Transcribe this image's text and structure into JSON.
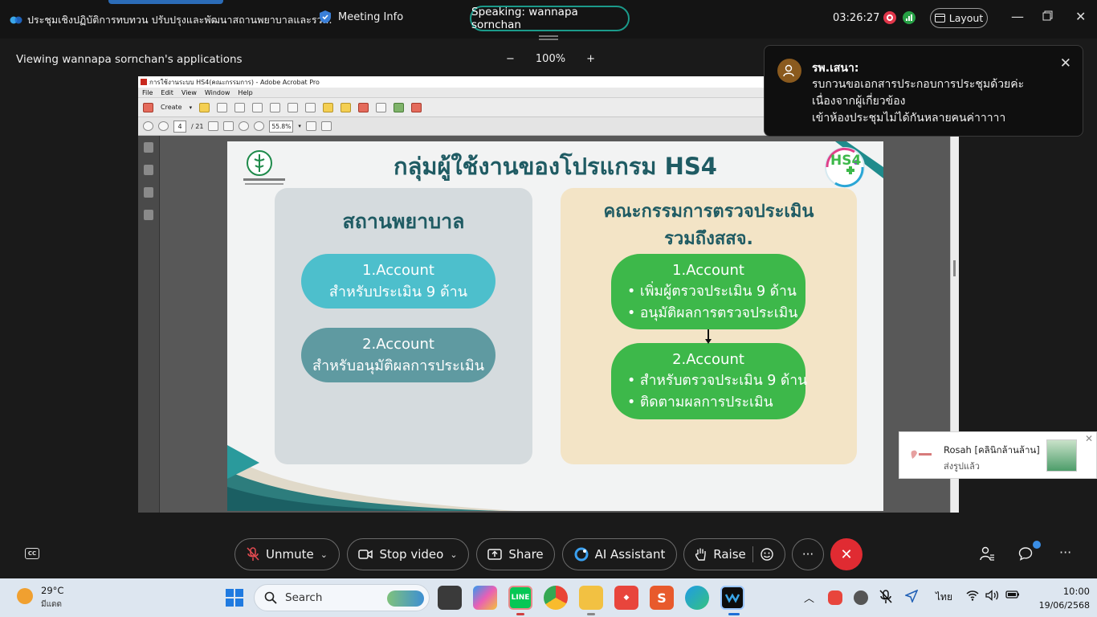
{
  "topbar": {
    "meeting_title": "ประชุมเชิงปฏิบัติการทบทวน ปรับปรุงและพัฒนาสถานพยาบาลและรว...",
    "meeting_info_label": "Meeting Info",
    "speaking_label": "Speaking: wannapa sornchan",
    "elapsed_time": "03:26:27",
    "layout_label": "Layout"
  },
  "share": {
    "viewing_label": "Viewing wannapa sornchan's applications",
    "zoom_minus": "−",
    "zoom_level": "100%",
    "zoom_plus": "+"
  },
  "acrobat": {
    "window_title": "การใช้งานระบบ HS4(คณะกรรมการ) - Adobe Acrobat Pro",
    "menu": [
      "File",
      "Edit",
      "View",
      "Window",
      "Help"
    ],
    "create_label": "Create",
    "page_current": "4",
    "page_total": "/ 21",
    "zoom_value": "55.8%"
  },
  "slide": {
    "title": "กลุ่มผู้ใช้งานของโปรแกรม HS4",
    "left_panel": {
      "heading": "สถานพยาบาล",
      "account1_title": "1.Account",
      "account1_desc": "สำหรับประเมิน 9 ด้าน",
      "account2_title": "2.Account",
      "account2_desc": "สำหรับอนุมัติผลการประเมิน"
    },
    "right_panel": {
      "heading_line1": "คณะกรรมการตรวจประเมิน",
      "heading_line2": "รวมถึงสสจ.",
      "account1_title": "1.Account",
      "account1_bullets": [
        "•  เพิ่มผู้ตรวจประเมิน 9 ด้าน",
        "•  อนุมัติผลการตรวจประเมิน"
      ],
      "account2_title": "2.Account",
      "account2_bullets": [
        "•  สำหรับตรวจประเมิน 9 ด้าน",
        "•  ติดตามผลการประเมิน"
      ]
    },
    "logo_right_text": "HS4"
  },
  "chat_notification": {
    "sender": "รพ.เสนา:",
    "message_lines": [
      "รบกวนขอเอกสารประกอบการประชุมด้วยค่ะ",
      "เนื่องจากผู้เกี่ยวข้อง",
      "เข้าห้องประชุมไม่ได้กันหลายคนค่าาาาา"
    ]
  },
  "line_toast": {
    "sender": "Rosah [คลินิกล้านล้าน]",
    "message": "ส่งรูปแล้ว"
  },
  "controls": {
    "unmute_label": "Unmute",
    "stop_video_label": "Stop video",
    "share_label": "Share",
    "ai_assistant_label": "AI Assistant",
    "raise_label": "Raise",
    "more_label": "···",
    "cc_label": "CC"
  },
  "taskbar": {
    "temperature": "29°C",
    "weather_desc": "มีแดด",
    "search_label": "Search",
    "language": "ไทย",
    "time": "10:00",
    "date": "19/06/2568"
  },
  "colors": {
    "speaking_border": "#1b9a8a",
    "end_call": "#e02b32",
    "slide_title": "#1f5b63",
    "pill_cyan": "#4dbfcc",
    "pill_teal": "#5f9aa1",
    "pill_green": "#3db84a"
  }
}
